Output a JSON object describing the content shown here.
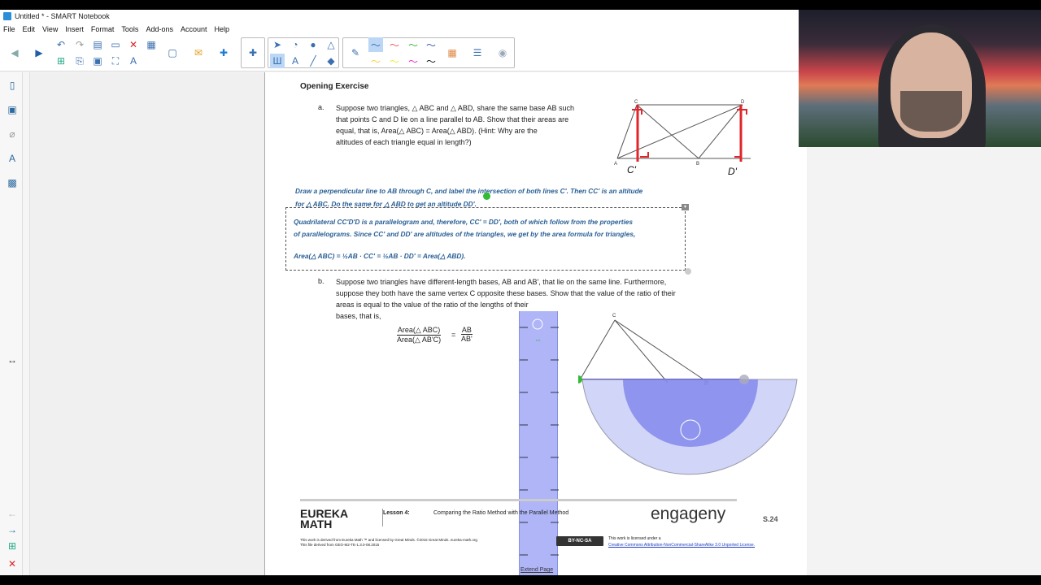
{
  "window": {
    "title": "Untitled * - SMART Notebook"
  },
  "menu": [
    "File",
    "Edit",
    "View",
    "Insert",
    "Format",
    "Tools",
    "Add-ons",
    "Account",
    "Help"
  ],
  "doc": {
    "heading": "Opening Exercise",
    "a_label": "a.",
    "a_lines": [
      "Suppose two triangles, △ ABC and △ ABD, share the same base AB such",
      "that points C and D lie on a line parallel to AB.  Show that their areas are",
      "equal, that is, Area(△ ABC) = Area(△ ABD).  (Hint:  Why are the",
      "altitudes of each triangle equal in length?)"
    ],
    "answer1_lines": [
      "Draw a perpendicular line to AB through C, and label the intersection of both lines C'.  Then CC' is an altitude",
      "for △ ABC.  Do the same for △ ABD to get an altitude DD'."
    ],
    "answer2_lines": [
      "Quadrilateral CC'D'D is a parallelogram and, therefore, CC' = DD', both of which follow from the properties",
      "of parallelograms.  Since CC' and DD' are altitudes of the triangles, we get by the area formula for triangles,",
      "Area(△ ABC) = ½AB · CC' = ½AB · DD' = Area(△ ABD)."
    ],
    "b_label": "b.",
    "b_lines": [
      "Suppose two triangles have different-length bases, AB and AB', that lie on the same line.  Furthermore,",
      "suppose they both have the same vertex C opposite these bases.  Show that the value of the ratio of their",
      "areas is equal to the value of the ratio of the lengths of their",
      "bases, that is,"
    ],
    "ratio_num": "Area(△ ABC)",
    "ratio_den": "Area(△ AB'C)",
    "ratio_rnum": "AB",
    "ratio_rden": "AB'",
    "footer": {
      "logo_line1": "EUREKA",
      "logo_line2": "MATH",
      "lesson": "Lesson 4:",
      "lesson_title": "Comparing the Ratio Method with the Parallel Method",
      "engage": "engageny",
      "page": "S.24",
      "license_small1": "This work is derived from Eureka Math ™ and licensed by Great Minds. ©2015 Great Minds. eureka-math.org",
      "license_small2": "This file derived from GEO-M2-TE-1.3.0-08.2015",
      "cc": "BY-NC-SA",
      "license_right1": "This work is licensed under a",
      "license_right2": "Creative Commons Attribution-NonCommercial-ShareAlike 3.0 Unported License."
    },
    "extend_page": "Extend Page",
    "diagram_labels": {
      "c": "C",
      "d": "D",
      "a": "A",
      "b": "B",
      "c_prime": "C'",
      "d_prime": "D'",
      "c2": "C",
      "b2": "B'"
    }
  },
  "colors": {
    "ruler": "#7b84ee",
    "answer": "#2a6096",
    "annotation": "#e0262b"
  }
}
